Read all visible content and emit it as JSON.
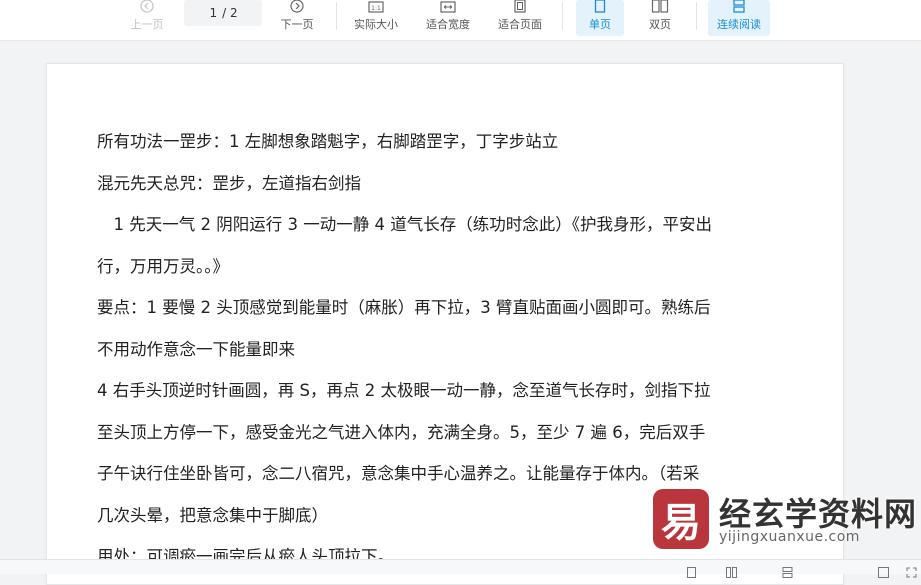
{
  "toolbar": {
    "prev_label": "上一页",
    "page_current": "1",
    "page_total": "/ 2",
    "next_label": "下一页",
    "actual_size_label": "实际大小",
    "fit_width_label": "适合宽度",
    "fit_page_label": "适合页面",
    "single_page_label": "单页",
    "double_page_label": "双页",
    "continuous_label": "连续阅读",
    "accent_color": "#1b8ed8"
  },
  "document": {
    "lines": [
      "所有功法一罡步：1 左脚想象踏魁字，右脚踏罡字，丁字步站立",
      "混元先天总咒：罡步，左道指右剑指",
      "　1 先天一气 2 阴阳运行 3 一动一静 4 道气长存（练功时念此）《护我身形，平安出",
      "行，万用万灵。。》",
      "要点：1 要慢 2 头顶感觉到能量时（麻胀）再下拉，3 臂直贴面画小圆即可。熟练后",
      "不用动作意念一下能量即来",
      "4 右手头顶逆时针画圆，再 S，再点 2 太极眼一动一静，念至道气长存时，剑指下拉",
      "至头顶上方停一下，感受金光之气进入体内，充满全身。5，至少 7 遍 6，完后双手",
      "子午诀行住坐卧皆可，念二八宿咒，意念集中手心温养之。让能量存于体内。（若采",
      "几次头晕，把意念集中于脚底）",
      "用处：可调瘀一画完后从瘀人头顶拉下。"
    ]
  },
  "watermark": {
    "title": "经玄学资料网",
    "url": "yijingxuanxue.com",
    "brand_color": "#b9363d"
  }
}
